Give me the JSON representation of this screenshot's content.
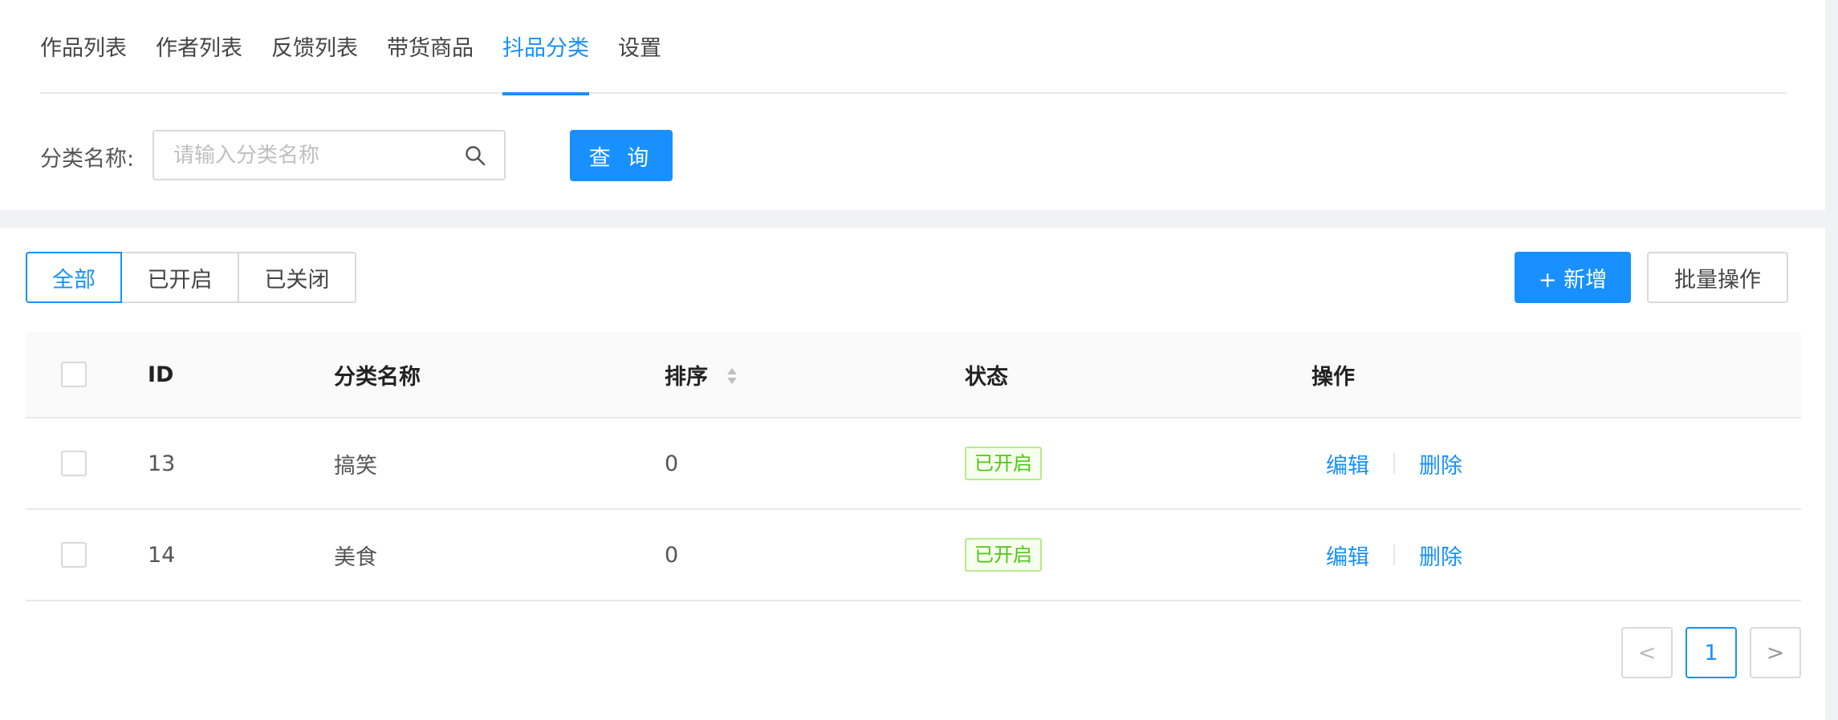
{
  "tabs": [
    {
      "label": "作品列表"
    },
    {
      "label": "作者列表"
    },
    {
      "label": "反馈列表"
    },
    {
      "label": "带货商品"
    },
    {
      "label": "抖品分类"
    },
    {
      "label": "设置"
    }
  ],
  "active_tab": "抖品分类",
  "filter": {
    "label": "分类名称:",
    "placeholder": "请输入分类名称",
    "value": "",
    "query_label": "查 询"
  },
  "status_filter": {
    "options": [
      "全部",
      "已开启",
      "已关闭"
    ],
    "selected": "全部"
  },
  "actions": {
    "add_label": "+ 新增",
    "batch_label": "批量操作"
  },
  "table": {
    "headers": {
      "id": "ID",
      "name": "分类名称",
      "sort": "排序",
      "status": "状态",
      "ops": "操作"
    },
    "rows": [
      {
        "id": "13",
        "name": "搞笑",
        "sort": "0",
        "status": "已开启",
        "edit": "编辑",
        "delete": "删除"
      },
      {
        "id": "14",
        "name": "美食",
        "sort": "0",
        "status": "已开启",
        "edit": "编辑",
        "delete": "删除"
      }
    ]
  },
  "pagination": {
    "prev": "<",
    "current": "1",
    "next": ">"
  },
  "colors": {
    "primary": "#1890ff",
    "success": "#52c41a",
    "border": "#d9d9d9",
    "background": "#f0f2f5"
  },
  "icons": {
    "search": "search-icon",
    "sort": "sort-arrows-icon",
    "prev": "chevron-left-icon",
    "next": "chevron-right-icon"
  }
}
